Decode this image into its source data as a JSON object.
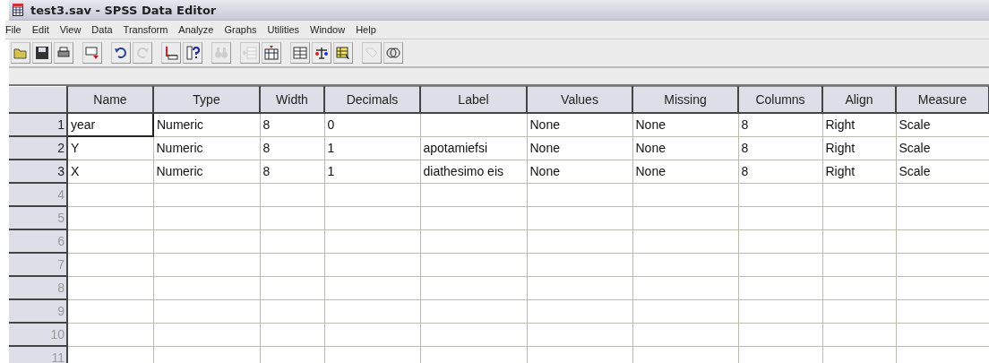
{
  "window": {
    "title": "test3.sav - SPSS Data Editor"
  },
  "menu": [
    "File",
    "Edit",
    "View",
    "Data",
    "Transform",
    "Analyze",
    "Graphs",
    "Utilities",
    "Window",
    "Help"
  ],
  "toolbar": [
    {
      "kind": "open",
      "disabled": false
    },
    {
      "kind": "save",
      "disabled": false
    },
    {
      "kind": "print",
      "disabled": false
    },
    {
      "kind": "dialog",
      "disabled": false
    },
    {
      "kind": "undo",
      "disabled": false
    },
    {
      "kind": "redo",
      "disabled": true
    },
    {
      "kind": "goto",
      "disabled": false
    },
    {
      "kind": "variables",
      "disabled": false
    },
    {
      "kind": "find",
      "disabled": true
    },
    {
      "kind": "insertcase",
      "disabled": true
    },
    {
      "kind": "insertvar",
      "disabled": false
    },
    {
      "kind": "split",
      "disabled": false
    },
    {
      "kind": "weight",
      "disabled": false
    },
    {
      "kind": "select",
      "disabled": false
    },
    {
      "kind": "labels",
      "disabled": true
    },
    {
      "kind": "sets",
      "disabled": false
    }
  ],
  "table": {
    "columns": [
      "Name",
      "Type",
      "Width",
      "Decimals",
      "Label",
      "Values",
      "Missing",
      "Columns",
      "Align",
      "Measure"
    ],
    "rows": [
      {
        "number": "1",
        "disabled": false,
        "selected": true,
        "cells": [
          "year",
          "Numeric",
          "8",
          "0",
          null,
          "None",
          "None",
          "8",
          "Right",
          "Scale"
        ]
      },
      {
        "number": "2",
        "disabled": false,
        "selected": false,
        "cells": [
          "Y",
          "Numeric",
          "8",
          "1",
          "apotamiefsi",
          "None",
          "None",
          "8",
          "Right",
          "Scale"
        ]
      },
      {
        "number": "3",
        "disabled": false,
        "selected": false,
        "cells": [
          "X",
          "Numeric",
          "8",
          "1",
          "diathesimo eis",
          "None",
          "None",
          "8",
          "Right",
          "Scale"
        ]
      },
      {
        "number": "4",
        "disabled": true,
        "selected": false,
        "cells": []
      },
      {
        "number": "5",
        "disabled": true,
        "selected": false,
        "cells": []
      },
      {
        "number": "6",
        "disabled": true,
        "selected": false,
        "cells": []
      },
      {
        "number": "7",
        "disabled": true,
        "selected": false,
        "cells": []
      },
      {
        "number": "8",
        "disabled": true,
        "selected": false,
        "cells": []
      },
      {
        "number": "9",
        "disabled": true,
        "selected": false,
        "cells": []
      },
      {
        "number": "10",
        "disabled": true,
        "selected": false,
        "cells": []
      },
      {
        "number": "11",
        "disabled": true,
        "selected": false,
        "cells": []
      }
    ]
  }
}
